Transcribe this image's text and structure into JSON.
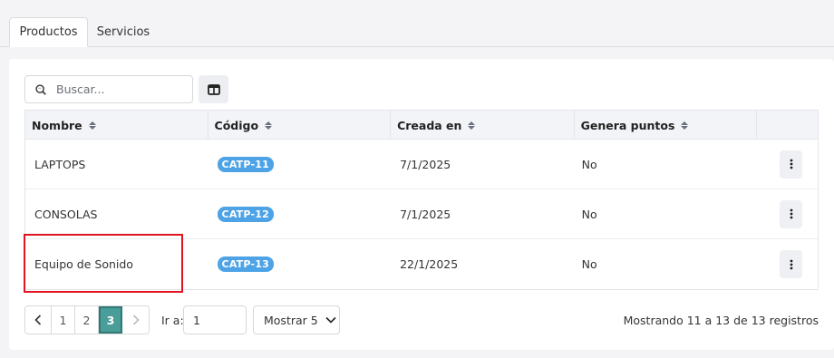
{
  "tabs": [
    {
      "label": "Productos",
      "active": true
    },
    {
      "label": "Servicios",
      "active": false
    }
  ],
  "toolbar": {
    "search_placeholder": "Buscar...",
    "search_value": "",
    "search_icon": "search-icon",
    "columns_icon": "columns-icon"
  },
  "table": {
    "headers": [
      "Nombre",
      "Código",
      "Creada en",
      "Genera puntos"
    ],
    "rows": [
      {
        "nombre": "LAPTOPS",
        "codigo": "CATP-11",
        "creada": "7/1/2025",
        "puntos": "No"
      },
      {
        "nombre": "CONSOLAS",
        "codigo": "CATP-12",
        "creada": "7/1/2025",
        "puntos": "No"
      },
      {
        "nombre": "Equipo de Sonido",
        "codigo": "CATP-13",
        "creada": "22/1/2025",
        "puntos": "No"
      }
    ],
    "row_action_icon": "more-vertical-icon"
  },
  "pagination": {
    "pages": [
      "1",
      "2",
      "3"
    ],
    "current_page": "3",
    "goto_label": "Ir a:",
    "goto_value": "1",
    "page_size_label": "Mostrar 5",
    "records_text": "Mostrando 11 a 13 de 13 registros"
  },
  "colors": {
    "badge": "#4da3e6",
    "active_page": "#4a9d98",
    "highlight": "#e0141e"
  }
}
